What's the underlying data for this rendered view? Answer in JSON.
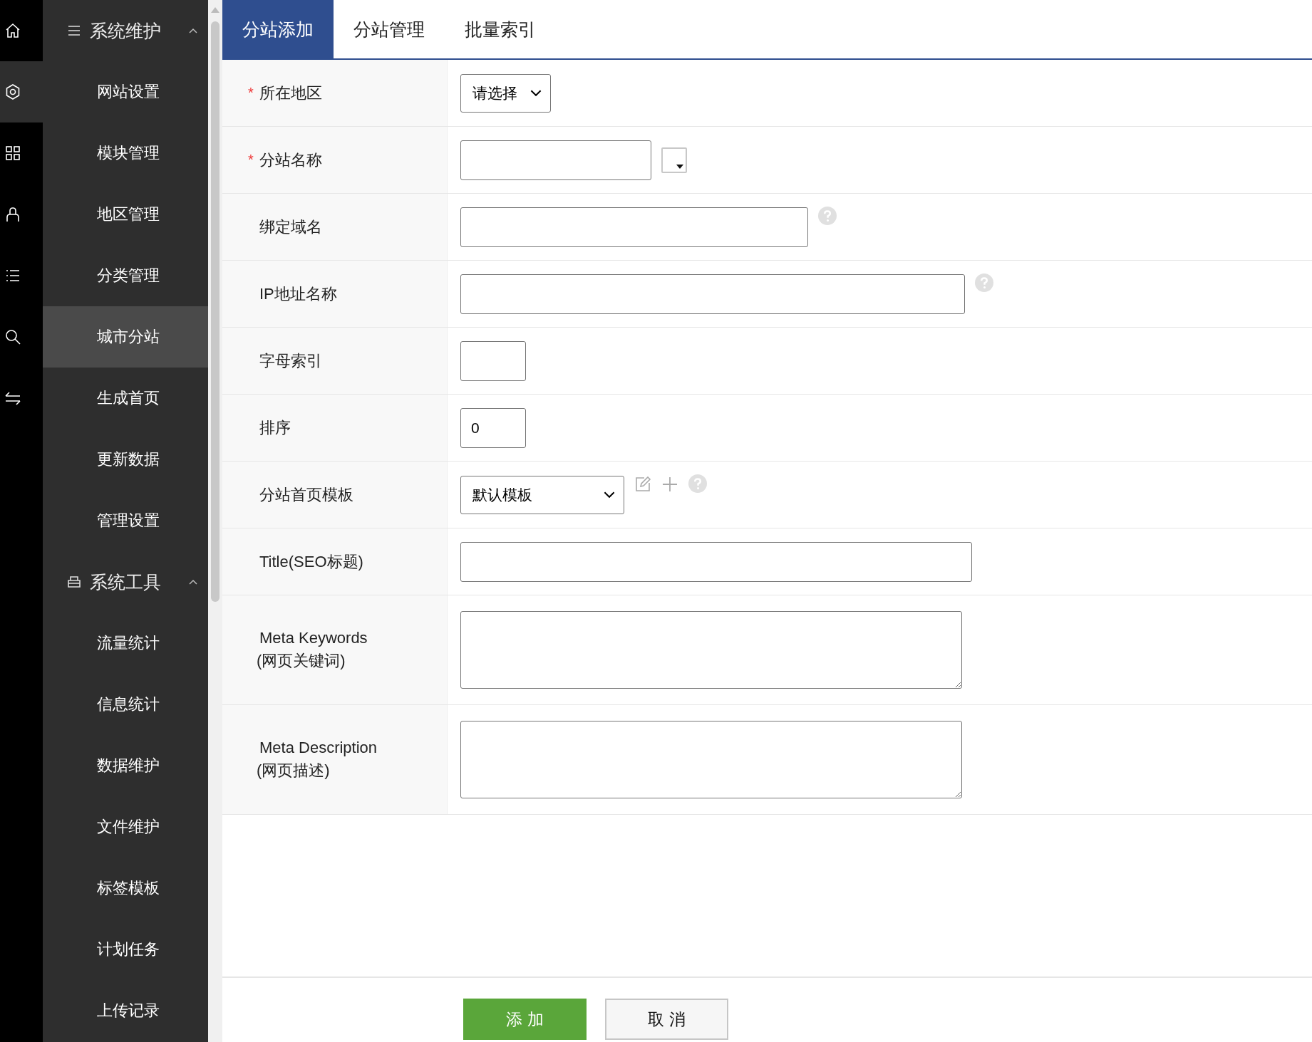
{
  "icon_rail": {
    "items": [
      {
        "kind": "home",
        "selected": false
      },
      {
        "kind": "gear",
        "selected": true
      },
      {
        "kind": "grid",
        "selected": false
      },
      {
        "kind": "user",
        "selected": false
      },
      {
        "kind": "list",
        "selected": false
      },
      {
        "kind": "search",
        "selected": false
      },
      {
        "kind": "swap",
        "selected": false
      }
    ]
  },
  "sidebar": {
    "groups": [
      {
        "label": "系统维护",
        "expanded": true,
        "items": [
          {
            "label": "网站设置",
            "selected": false
          },
          {
            "label": "模块管理",
            "selected": false
          },
          {
            "label": "地区管理",
            "selected": false
          },
          {
            "label": "分类管理",
            "selected": false
          },
          {
            "label": "城市分站",
            "selected": true
          },
          {
            "label": "生成首页",
            "selected": false
          },
          {
            "label": "更新数据",
            "selected": false
          },
          {
            "label": "管理设置",
            "selected": false
          }
        ]
      },
      {
        "label": "系统工具",
        "expanded": true,
        "items": [
          {
            "label": "流量统计",
            "selected": false
          },
          {
            "label": "信息统计",
            "selected": false
          },
          {
            "label": "数据维护",
            "selected": false
          },
          {
            "label": "文件维护",
            "selected": false
          },
          {
            "label": "标签模板",
            "selected": false
          },
          {
            "label": "计划任务",
            "selected": false
          },
          {
            "label": "上传记录",
            "selected": false
          }
        ]
      }
    ]
  },
  "tabs": [
    {
      "label": "分站添加",
      "selected": true
    },
    {
      "label": "分站管理",
      "selected": false
    },
    {
      "label": "批量索引",
      "selected": false
    }
  ],
  "form": {
    "rows": [
      {
        "label": "所在地区",
        "required_mark": "*",
        "kind": "select",
        "value": "请选择",
        "tools": []
      },
      {
        "label": "分站名称",
        "required_mark": "*",
        "kind": "text",
        "tools": [
          {
            "kind": "color-picker"
          }
        ]
      },
      {
        "label": "绑定域名",
        "kind": "text",
        "tools": [
          {
            "kind": "help"
          }
        ]
      },
      {
        "label": "IP地址名称",
        "kind": "text",
        "tools": [
          {
            "kind": "help"
          }
        ]
      },
      {
        "label": "字母索引",
        "kind": "text",
        "tools": []
      },
      {
        "label": "排序",
        "kind": "text",
        "value": "0",
        "tools": []
      },
      {
        "label": "分站首页模板",
        "kind": "select",
        "value": "默认模板",
        "tools": [
          {
            "kind": "edit"
          },
          {
            "kind": "add"
          },
          {
            "kind": "help"
          }
        ]
      },
      {
        "label": "Title(SEO标题)",
        "kind": "text",
        "tools": []
      },
      {
        "label": "Meta Keywords",
        "sublabel": "(网页关键词)",
        "kind": "textarea",
        "tools": []
      },
      {
        "label": "Meta Description",
        "sublabel": "(网页描述)",
        "kind": "textarea",
        "tools": []
      }
    ]
  },
  "buttons": [
    {
      "label": "添 加",
      "kind": "primary"
    },
    {
      "label": "取 消",
      "kind": "secondary"
    }
  ]
}
